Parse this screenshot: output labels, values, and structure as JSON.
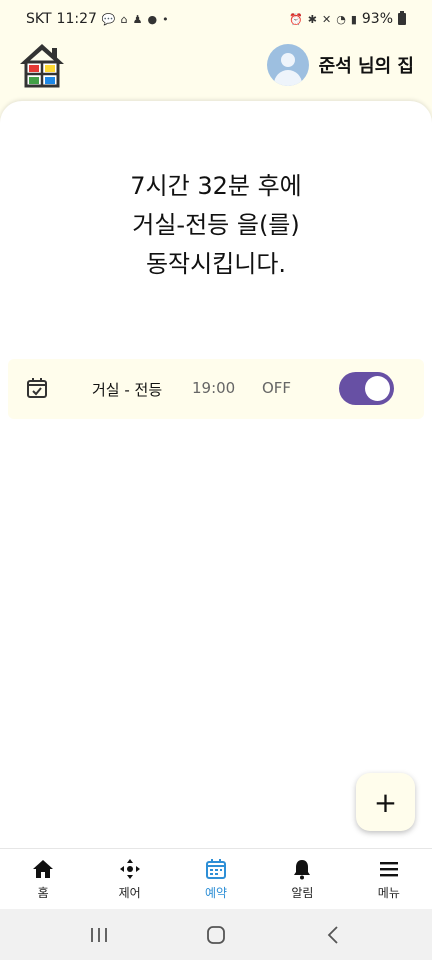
{
  "status_bar": {
    "carrier": "SKT",
    "time": "11:27",
    "battery": "93%"
  },
  "header": {
    "user_name": "준석 님의 집"
  },
  "countdown": {
    "line1": "7시간 32분 후에",
    "line2": "거실-전등 을(를)",
    "line3": "동작시킵니다."
  },
  "schedule": {
    "device": "거실 - 전등",
    "time": "19:00",
    "action": "OFF",
    "enabled": true
  },
  "fab": {
    "label": "+"
  },
  "bottom_nav": {
    "items": [
      {
        "label": "홈",
        "icon": "home-icon"
      },
      {
        "label": "제어",
        "icon": "move-arrows-icon"
      },
      {
        "label": "예약",
        "icon": "calendar-icon",
        "active": true
      },
      {
        "label": "알림",
        "icon": "bell-icon"
      },
      {
        "label": "메뉴",
        "icon": "hamburger-icon"
      }
    ]
  },
  "colors": {
    "accent": "#6750a4",
    "active_nav": "#2e8fd6",
    "header_bg": "#fffdec"
  }
}
